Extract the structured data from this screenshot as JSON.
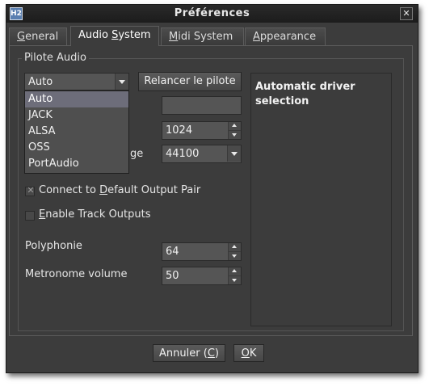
{
  "window": {
    "title": "Préférences",
    "app_icon_label": "H2",
    "close_glyph": "✕"
  },
  "tabs": [
    {
      "pre": "",
      "ul": "G",
      "post": "eneral"
    },
    {
      "pre": "Audio ",
      "ul": "S",
      "post": "ystem"
    },
    {
      "pre": "",
      "ul": "M",
      "post": "idi System"
    },
    {
      "pre": "",
      "ul": "A",
      "post": "ppearance"
    }
  ],
  "group": {
    "title": "Pilote Audio"
  },
  "driver": {
    "selected": "Auto",
    "options": [
      "Auto",
      "JACK",
      "ALSA",
      "OSS",
      "PortAudio"
    ],
    "restart_label": "Relancer le pilote"
  },
  "buffer": {
    "value": "1024"
  },
  "sample_rate": {
    "label_fragment": "ge",
    "value": "44100"
  },
  "options": {
    "connect_pre": "Connect to ",
    "connect_ul": "D",
    "connect_post": "efault Output Pair",
    "connect_checked": true,
    "tracks_pre": "",
    "tracks_ul": "E",
    "tracks_post": "nable Track Outputs",
    "tracks_checked": false,
    "check_glyph": "✕"
  },
  "polyphony": {
    "label": "Polyphonie",
    "value": "64"
  },
  "metronome": {
    "label": "Metronome volume",
    "value": "50"
  },
  "description": "Automatic driver selection",
  "buttons": {
    "cancel_pre": "Annuler (",
    "cancel_ul": "C",
    "cancel_post": ")",
    "ok_ul": "O",
    "ok_post": "K"
  }
}
